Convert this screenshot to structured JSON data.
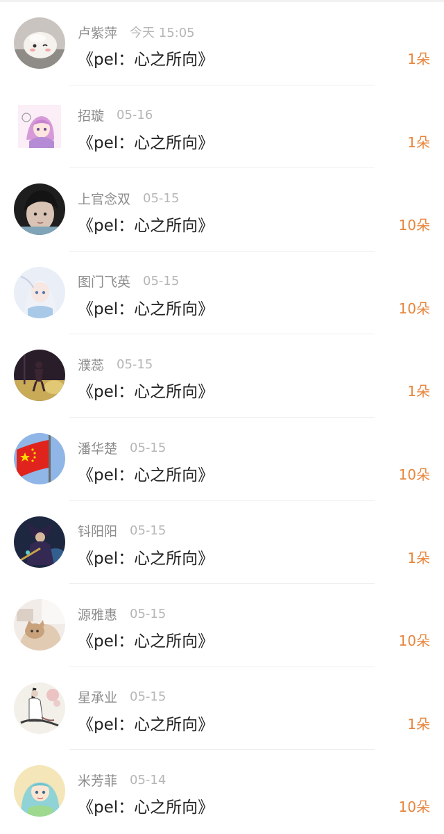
{
  "accent_color": "#e7853c",
  "records": [
    {
      "name": "卢紫萍",
      "time": "今天 15:05",
      "gift": "《pel：心之所向》",
      "amount": "1朵",
      "avatar": "avatar-cute-mochi-icon"
    },
    {
      "name": "招璇",
      "time": "05-16",
      "gift": "《pel：心之所向》",
      "amount": "1朵",
      "avatar": "avatar-anime-girl-pink-icon"
    },
    {
      "name": "上官念双",
      "time": "05-15",
      "gift": "《pel：心之所向》",
      "amount": "10朵",
      "avatar": "avatar-child-photo-icon"
    },
    {
      "name": "图门飞英",
      "time": "05-15",
      "gift": "《pel：心之所向》",
      "amount": "10朵",
      "avatar": "avatar-fairy-doll-icon"
    },
    {
      "name": "濮蕊",
      "time": "05-15",
      "gift": "《pel：心之所向》",
      "amount": "1朵",
      "avatar": "avatar-night-silhouette-icon"
    },
    {
      "name": "潘华楚",
      "time": "05-15",
      "gift": "《pel：心之所向》",
      "amount": "10朵",
      "avatar": "avatar-red-flag-icon"
    },
    {
      "name": "钭阳阳",
      "time": "05-15",
      "gift": "《pel：心之所向》",
      "amount": "1朵",
      "avatar": "avatar-game-character-icon"
    },
    {
      "name": "源雅惠",
      "time": "05-15",
      "gift": "《pel：心之所向》",
      "amount": "10朵",
      "avatar": "avatar-cat-photo-icon"
    },
    {
      "name": "星承业",
      "time": "05-15",
      "gift": "《pel：心之所向》",
      "amount": "1朵",
      "avatar": "avatar-ink-painting-icon"
    },
    {
      "name": "米芳菲",
      "time": "05-14",
      "gift": "《pel：心之所向》",
      "amount": "10朵",
      "avatar": "avatar-cartoon-girl-icon"
    }
  ]
}
